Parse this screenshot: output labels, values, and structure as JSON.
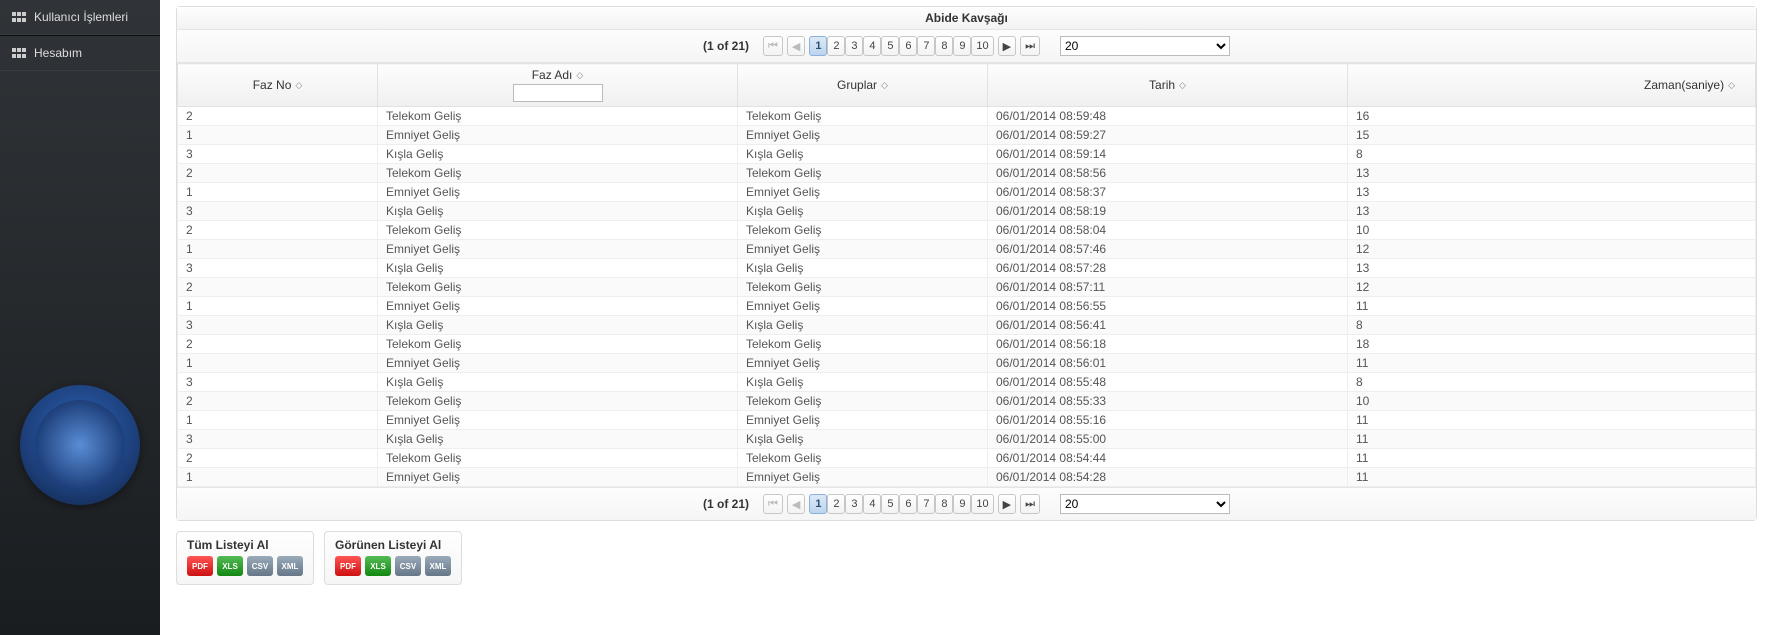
{
  "sidebar": {
    "items": [
      {
        "label": "Kullanıcı İşlemleri"
      },
      {
        "label": "Hesabım"
      }
    ]
  },
  "panel": {
    "title": "Abide Kavşağı"
  },
  "pager": {
    "info": "(1 of 21)",
    "first": "⏮",
    "prev": "◀",
    "next": "▶",
    "last": "⏭",
    "pages": [
      "1",
      "2",
      "3",
      "4",
      "5",
      "6",
      "7",
      "8",
      "9",
      "10"
    ],
    "activePage": "1",
    "rowsPerPage": "20"
  },
  "columns": {
    "fazno": "Faz No",
    "fazadi": "Faz Adı",
    "gruplar": "Gruplar",
    "tarih": "Tarih",
    "zaman": "Zaman(saniye)"
  },
  "filter": {
    "fazadi": ""
  },
  "rows": [
    {
      "fazno": "2",
      "fazadi": "Telekom Geliş",
      "grup": "Telekom Geliş",
      "tarih": "06/01/2014 08:59:48",
      "zaman": "16"
    },
    {
      "fazno": "1",
      "fazadi": "Emniyet Geliş",
      "grup": "Emniyet Geliş",
      "tarih": "06/01/2014 08:59:27",
      "zaman": "15"
    },
    {
      "fazno": "3",
      "fazadi": "Kışla Geliş",
      "grup": "Kışla Geliş",
      "tarih": "06/01/2014 08:59:14",
      "zaman": "8"
    },
    {
      "fazno": "2",
      "fazadi": "Telekom Geliş",
      "grup": "Telekom Geliş",
      "tarih": "06/01/2014 08:58:56",
      "zaman": "13"
    },
    {
      "fazno": "1",
      "fazadi": "Emniyet Geliş",
      "grup": "Emniyet Geliş",
      "tarih": "06/01/2014 08:58:37",
      "zaman": "13"
    },
    {
      "fazno": "3",
      "fazadi": "Kışla Geliş",
      "grup": "Kışla Geliş",
      "tarih": "06/01/2014 08:58:19",
      "zaman": "13"
    },
    {
      "fazno": "2",
      "fazadi": "Telekom Geliş",
      "grup": "Telekom Geliş",
      "tarih": "06/01/2014 08:58:04",
      "zaman": "10"
    },
    {
      "fazno": "1",
      "fazadi": "Emniyet Geliş",
      "grup": "Emniyet Geliş",
      "tarih": "06/01/2014 08:57:46",
      "zaman": "12"
    },
    {
      "fazno": "3",
      "fazadi": "Kışla Geliş",
      "grup": "Kışla Geliş",
      "tarih": "06/01/2014 08:57:28",
      "zaman": "13"
    },
    {
      "fazno": "2",
      "fazadi": "Telekom Geliş",
      "grup": "Telekom Geliş",
      "tarih": "06/01/2014 08:57:11",
      "zaman": "12"
    },
    {
      "fazno": "1",
      "fazadi": "Emniyet Geliş",
      "grup": "Emniyet Geliş",
      "tarih": "06/01/2014 08:56:55",
      "zaman": "11"
    },
    {
      "fazno": "3",
      "fazadi": "Kışla Geliş",
      "grup": "Kışla Geliş",
      "tarih": "06/01/2014 08:56:41",
      "zaman": "8"
    },
    {
      "fazno": "2",
      "fazadi": "Telekom Geliş",
      "grup": "Telekom Geliş",
      "tarih": "06/01/2014 08:56:18",
      "zaman": "18"
    },
    {
      "fazno": "1",
      "fazadi": "Emniyet Geliş",
      "grup": "Emniyet Geliş",
      "tarih": "06/01/2014 08:56:01",
      "zaman": "11"
    },
    {
      "fazno": "3",
      "fazadi": "Kışla Geliş",
      "grup": "Kışla Geliş",
      "tarih": "06/01/2014 08:55:48",
      "zaman": "8"
    },
    {
      "fazno": "2",
      "fazadi": "Telekom Geliş",
      "grup": "Telekom Geliş",
      "tarih": "06/01/2014 08:55:33",
      "zaman": "10"
    },
    {
      "fazno": "1",
      "fazadi": "Emniyet Geliş",
      "grup": "Emniyet Geliş",
      "tarih": "06/01/2014 08:55:16",
      "zaman": "11"
    },
    {
      "fazno": "3",
      "fazadi": "Kışla Geliş",
      "grup": "Kışla Geliş",
      "tarih": "06/01/2014 08:55:00",
      "zaman": "11"
    },
    {
      "fazno": "2",
      "fazadi": "Telekom Geliş",
      "grup": "Telekom Geliş",
      "tarih": "06/01/2014 08:54:44",
      "zaman": "11"
    },
    {
      "fazno": "1",
      "fazadi": "Emniyet Geliş",
      "grup": "Emniyet Geliş",
      "tarih": "06/01/2014 08:54:28",
      "zaman": "11"
    }
  ],
  "export": {
    "all": "Tüm Listeyi Al",
    "visible": "Görünen Listeyi Al",
    "pdf": "PDF",
    "xls": "XLS",
    "csv": "CSV",
    "xml": "XML"
  }
}
